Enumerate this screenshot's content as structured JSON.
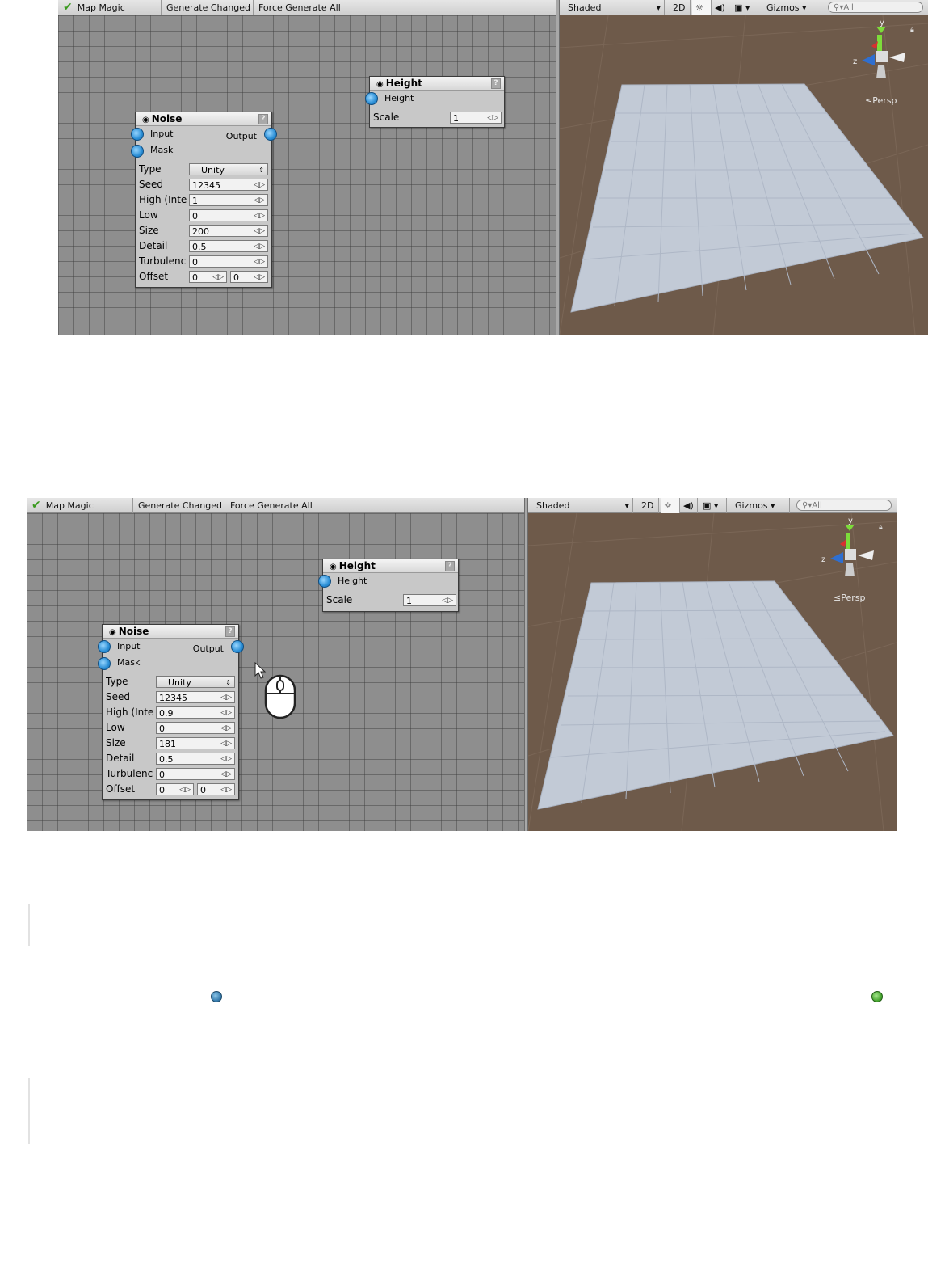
{
  "toolbar": {
    "app_label": "Map Magic",
    "generate_changed": "Generate Changed",
    "force_generate_all": "Force Generate All"
  },
  "scene_toolbar": {
    "shading_mode": "Shaded",
    "mode_2d": "2D",
    "gizmos": "Gizmos",
    "search_placeholder": "All",
    "persp_label": "Persp",
    "axis_y": "y",
    "axis_z": "z"
  },
  "screenshots": [
    {
      "height_node": {
        "title": "Height",
        "input_label": "Height",
        "scale_label": "Scale",
        "scale_value": "1"
      },
      "noise_node": {
        "title": "Noise",
        "input_label": "Input",
        "output_label": "Output",
        "mask_label": "Mask",
        "type_label": "Type",
        "type_value": "Unity",
        "seed_label": "Seed",
        "seed_value": "12345",
        "high_label": "High (Inte",
        "high_value": "1",
        "low_label": "Low",
        "low_value": "0",
        "size_label": "Size",
        "size_value": "200",
        "detail_label": "Detail",
        "detail_value": "0.5",
        "turbulence_label": "Turbulenc",
        "turbulence_value": "0",
        "offset_label": "Offset",
        "offset_x": "0",
        "offset_y": "0"
      }
    },
    {
      "height_node": {
        "title": "Height",
        "input_label": "Height",
        "scale_label": "Scale",
        "scale_value": "1"
      },
      "noise_node": {
        "title": "Noise",
        "input_label": "Input",
        "output_label": "Output",
        "mask_label": "Mask",
        "type_label": "Type",
        "type_value": "Unity",
        "seed_label": "Seed",
        "seed_value": "12345",
        "high_label": "High (Inte",
        "high_value": "0.9",
        "low_label": "Low",
        "low_value": "0",
        "size_label": "Size",
        "size_value": "181",
        "detail_label": "Detail",
        "detail_value": "0.5",
        "turbulence_label": "Turbulenc",
        "turbulence_value": "0",
        "offset_label": "Offset",
        "offset_x": "0",
        "offset_y": "0"
      }
    }
  ],
  "icons": {
    "eye": "eye-icon",
    "help": "help-icon",
    "drag": "drag-arrows-icon",
    "port": "port-icon",
    "mouse": "mouse-icon",
    "cursor": "cursor-icon",
    "lock": "lock-icon",
    "sun": "sun-icon",
    "audio": "audio-icon",
    "image": "image-icon",
    "search": "search-icon"
  },
  "colors": {
    "port_blue": "#2a8ed6",
    "port_green": "#4aa832",
    "ground": "#6e5a4a",
    "plane": "#c2cad6"
  }
}
